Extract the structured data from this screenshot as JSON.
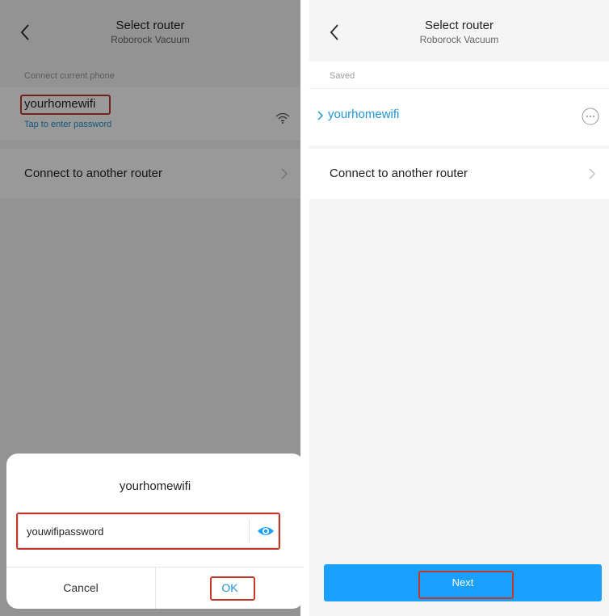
{
  "left": {
    "header": {
      "title": "Select router",
      "subtitle": "Roborock Vacuum"
    },
    "section_label": "Connect current phone",
    "network": {
      "name": "yourhomewifi",
      "hint": "Tap to enter password"
    },
    "another_router_label": "Connect to another router",
    "dialog": {
      "title": "yourhomewifi",
      "password_value": "youwifipassword",
      "cancel_label": "Cancel",
      "ok_label": "OK"
    }
  },
  "right": {
    "header": {
      "title": "Select router",
      "subtitle": "Roborock Vacuum"
    },
    "section_label": "Saved",
    "saved_network": "yourhomewifi",
    "another_router_label": "Connect to another router",
    "next_label": "Next"
  },
  "colors": {
    "accent": "#1aa1ff",
    "link": "#2196d3",
    "highlight": "#c0392b"
  }
}
